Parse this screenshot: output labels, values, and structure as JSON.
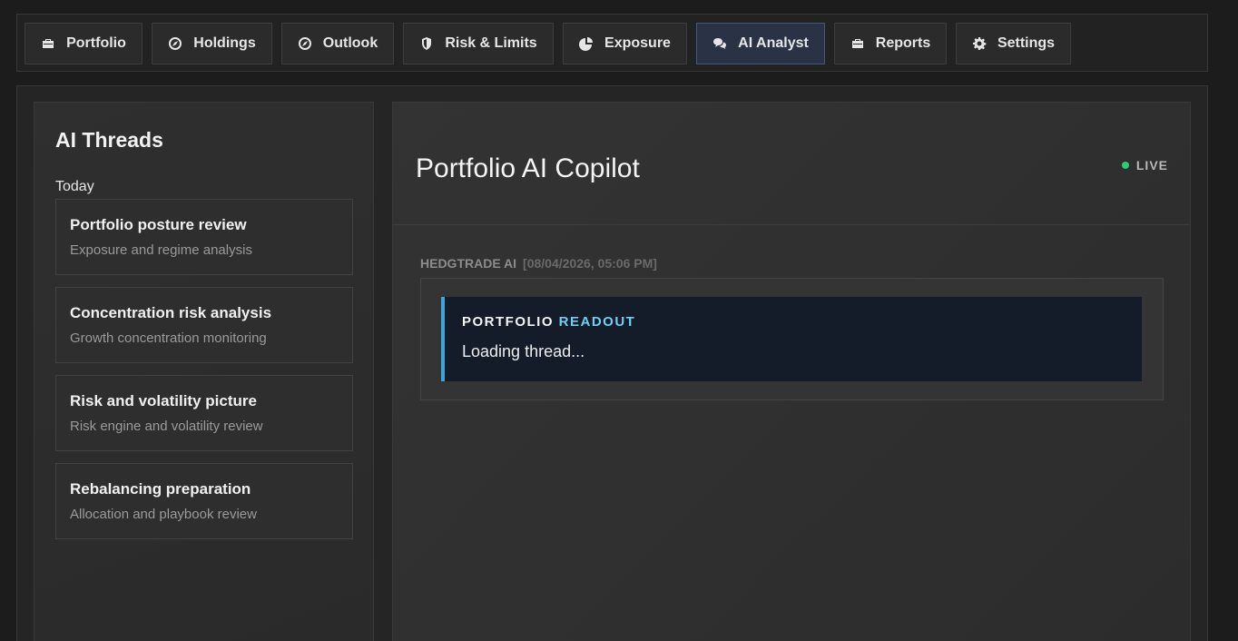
{
  "nav": {
    "tabs": [
      {
        "label": "Portfolio",
        "icon": "briefcase-icon"
      },
      {
        "label": "Holdings",
        "icon": "compass-icon"
      },
      {
        "label": "Outlook",
        "icon": "compass-icon"
      },
      {
        "label": "Risk & Limits",
        "icon": "shield-icon"
      },
      {
        "label": "Exposure",
        "icon": "pie-chart-icon"
      },
      {
        "label": "AI Analyst",
        "icon": "chat-icon",
        "active": true
      },
      {
        "label": "Reports",
        "icon": "briefcase-icon"
      },
      {
        "label": "Settings",
        "icon": "gear-icon"
      }
    ]
  },
  "threads": {
    "title": "AI Threads",
    "group_label": "Today",
    "items": [
      {
        "title": "Portfolio posture review",
        "subtitle": "Exposure and regime analysis"
      },
      {
        "title": "Concentration risk analysis",
        "subtitle": "Growth concentration monitoring"
      },
      {
        "title": "Risk and volatility picture",
        "subtitle": "Risk engine and volatility review"
      },
      {
        "title": "Rebalancing preparation",
        "subtitle": "Allocation and playbook review"
      }
    ]
  },
  "copilot": {
    "title": "Portfolio AI Copilot",
    "status": "LIVE",
    "status_color": "#2ecc71",
    "message": {
      "author": "HEDGTRADE AI",
      "timestamp": "[08/04/2026, 05:06 PM]",
      "readout_title": "PORTFOLIO",
      "readout_accent": "READOUT",
      "body": "Loading thread..."
    }
  },
  "colors": {
    "accent": "#3fa3dc",
    "accent_text": "#6fd0f5",
    "active_tab_bg": "#2a3346"
  }
}
